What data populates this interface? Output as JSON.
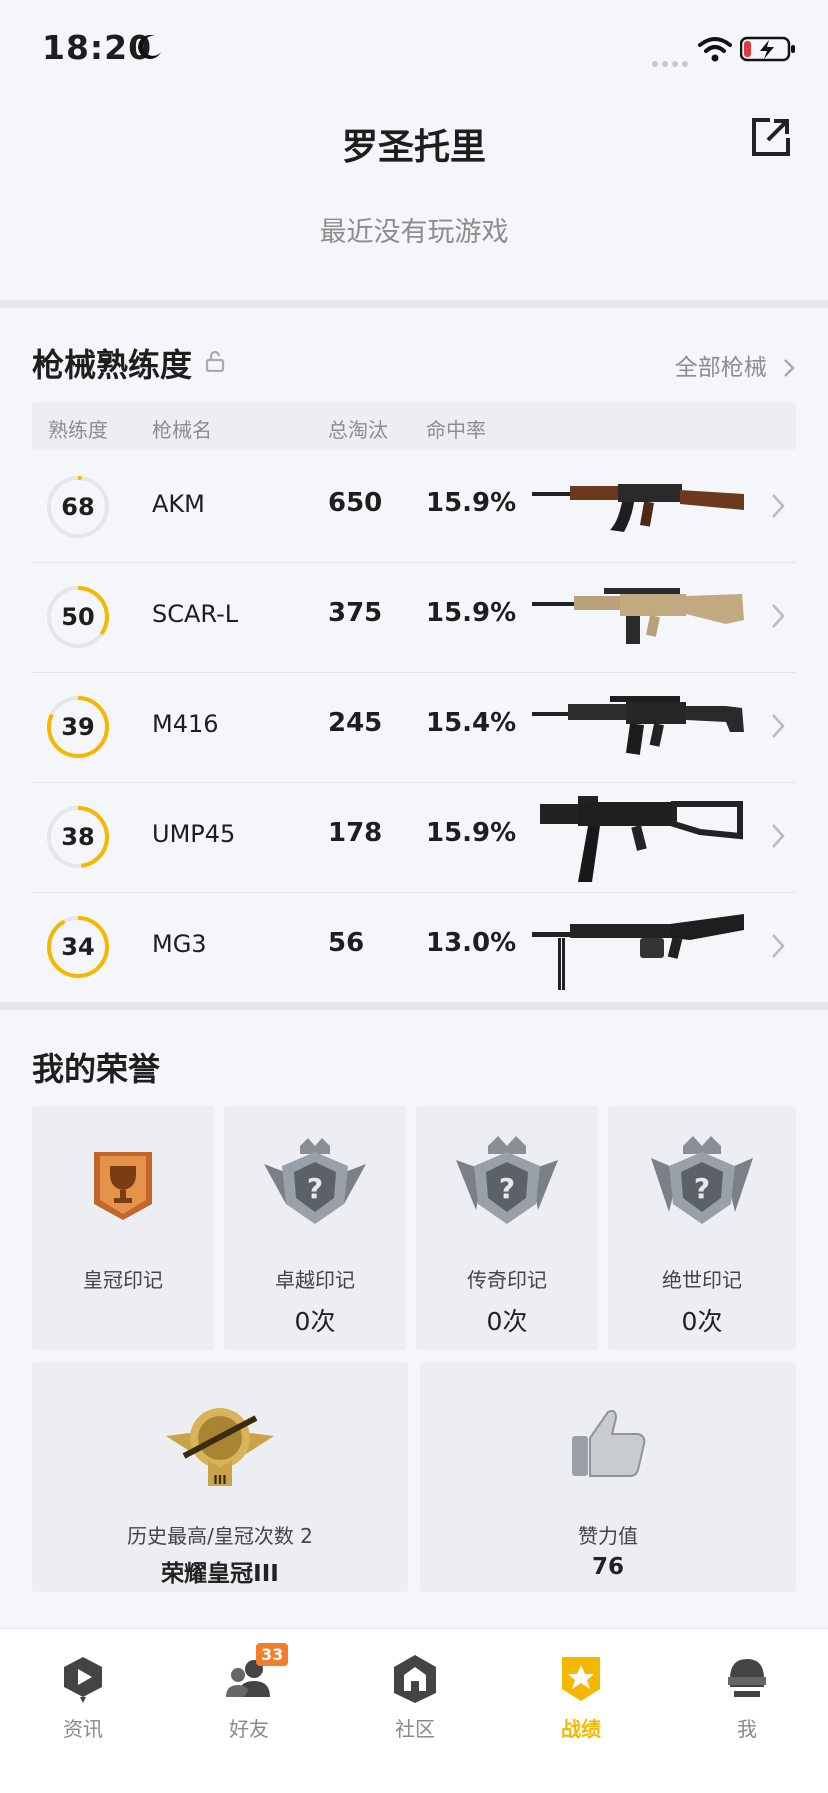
{
  "status_bar": {
    "time": "18:20"
  },
  "header": {
    "title": "罗圣托里",
    "subtitle": "最近没有玩游戏"
  },
  "weapons": {
    "section_title": "枪械熟练度",
    "all_link": "全部枪械",
    "columns": [
      "熟练度",
      "枪械名",
      "总淘汰",
      "命中率"
    ],
    "rows": [
      {
        "level": "68",
        "progress": 0.02,
        "name": "AKM",
        "kills": "650",
        "hit_rate": "15.9%"
      },
      {
        "level": "50",
        "progress": 0.35,
        "name": "SCAR-L",
        "kills": "375",
        "hit_rate": "15.9%"
      },
      {
        "level": "39",
        "progress": 0.82,
        "name": "M416",
        "kills": "245",
        "hit_rate": "15.4%"
      },
      {
        "level": "38",
        "progress": 0.48,
        "name": "UMP45",
        "kills": "178",
        "hit_rate": "15.9%"
      },
      {
        "level": "34",
        "progress": 0.92,
        "name": "MG3",
        "kills": "56",
        "hit_rate": "13.0%"
      }
    ],
    "accent_color": "#f5b800"
  },
  "honor": {
    "section_title": "我的荣誉",
    "cards": [
      {
        "label": "皇冠印记",
        "count": ""
      },
      {
        "label": "卓越印记",
        "count": "0次"
      },
      {
        "label": "传奇印记",
        "count": "0次"
      },
      {
        "label": "绝世印记",
        "count": "0次"
      }
    ],
    "history": {
      "label": "历史最高/皇冠次数 2",
      "value": "荣耀皇冠III"
    },
    "likes": {
      "label": "赞力值",
      "value": "76"
    }
  },
  "tab_bar": {
    "tabs": [
      {
        "label": "资讯",
        "icon": "news-icon"
      },
      {
        "label": "好友",
        "icon": "friends-icon",
        "badge": "33"
      },
      {
        "label": "社区",
        "icon": "community-icon"
      },
      {
        "label": "战绩",
        "icon": "record-icon",
        "active": true
      },
      {
        "label": "我",
        "icon": "profile-icon"
      }
    ]
  }
}
